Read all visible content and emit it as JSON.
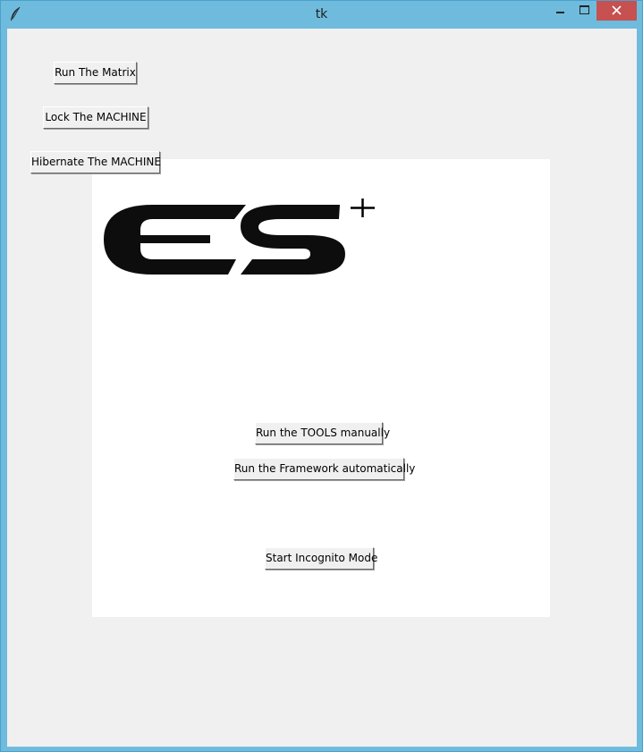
{
  "window": {
    "title": "tk"
  },
  "buttons": {
    "run_matrix": "Run The Matrix",
    "lock_machine": "Lock The MACHINE",
    "hibernate_machine": "Hibernate The MACHINE",
    "run_tools_manually": "Run the TOOLS manually",
    "run_framework_auto": "Run the Framework automatically",
    "start_incognito": "Start Incognito Mode"
  },
  "icons": {
    "app": "tk-feather-icon",
    "minimize": "minimize-icon",
    "maximize": "maximize-icon",
    "close": "close-icon",
    "cursor": "crosshair-cursor-icon"
  },
  "logo": {
    "text": "ES"
  },
  "colors": {
    "titlebar": "#6fbbdd",
    "client": "#f0f0f0",
    "canvas": "#ffffff",
    "close": "#c75050",
    "logo": "#0d0d0d"
  }
}
